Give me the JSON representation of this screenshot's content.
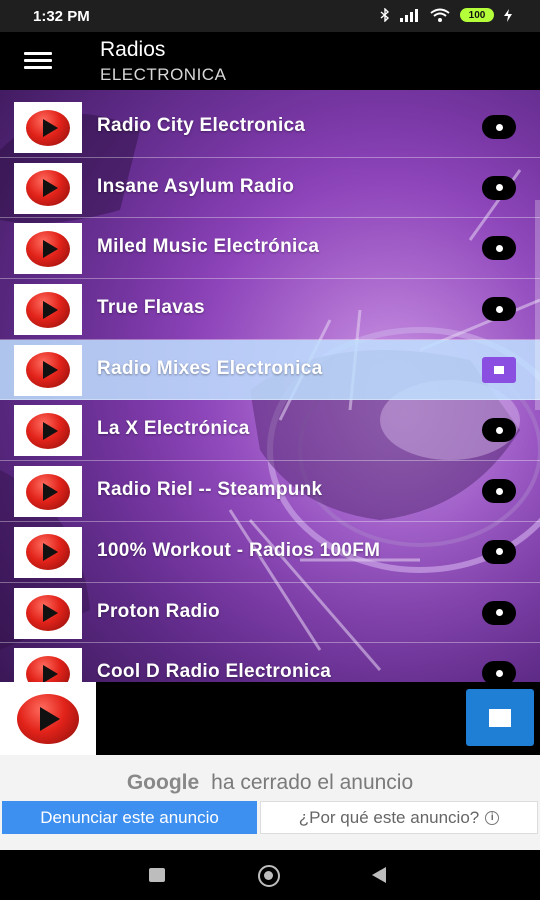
{
  "status_bar": {
    "time": "1:32 PM",
    "battery": "100",
    "icons": [
      "bluetooth-icon",
      "signal-icon",
      "wifi-icon",
      "battery-icon",
      "charging-icon"
    ]
  },
  "header": {
    "title": "Radios",
    "subtitle": "ELECTRONICA"
  },
  "stations": [
    {
      "name": "Radio City Electronica",
      "playing": false
    },
    {
      "name": "Insane Asylum Radio",
      "playing": false
    },
    {
      "name": "Miled Music Electrónica",
      "playing": false
    },
    {
      "name": "True Flavas",
      "playing": false
    },
    {
      "name": "Radio Mixes Electronica",
      "playing": true
    },
    {
      "name": "La X Electrónica",
      "playing": false
    },
    {
      "name": "Radio Riel -- Steampunk",
      "playing": false
    },
    {
      "name": "100% Workout - Radios 100FM",
      "playing": false
    },
    {
      "name": "Proton Radio",
      "playing": false
    },
    {
      "name": "Cool D Radio Electronica",
      "playing": false
    }
  ],
  "ad": {
    "brand": "Google",
    "message": "ha cerrado el anuncio",
    "report_label": "Denunciar este anuncio",
    "why_label": "¿Por qué este anuncio?"
  },
  "colors": {
    "active_row": "#bee1ff",
    "stop_accent": "#8a4fe0",
    "player_stop": "#1e7fd4",
    "ad_button": "#3d8ff0"
  }
}
